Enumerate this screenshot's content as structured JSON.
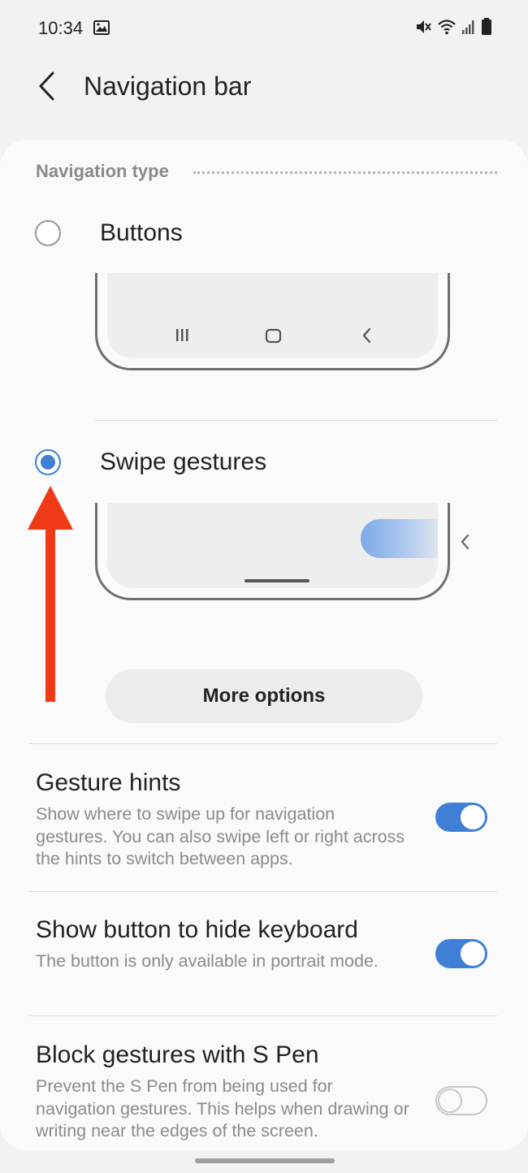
{
  "status_bar": {
    "time": "10:34",
    "icons": [
      "image-icon",
      "mute-icon",
      "wifi-icon",
      "signal-icon",
      "battery-icon"
    ]
  },
  "app_bar": {
    "title": "Navigation bar",
    "back_icon": "back-chevron-icon"
  },
  "navigation_type": {
    "section_title": "Navigation type",
    "options": [
      {
        "label": "Buttons",
        "selected": false
      },
      {
        "label": "Swipe gestures",
        "selected": true
      }
    ],
    "more_options_label": "More options"
  },
  "settings": [
    {
      "title": "Gesture hints",
      "description": "Show where to swipe up for navigation gestures. You can also swipe left or right across the hints to switch between apps.",
      "enabled": true
    },
    {
      "title": "Show button to hide keyboard",
      "description": "The button is only available in portrait mode.",
      "enabled": true
    },
    {
      "title": "Block gestures with S Pen",
      "description": "Prevent the S Pen from being used for navigation gestures. This helps when drawing or writing near the edges of the screen.",
      "enabled": false
    }
  ],
  "colors": {
    "accent": "#3f7fd6",
    "annotation_arrow": "#f03a17"
  }
}
